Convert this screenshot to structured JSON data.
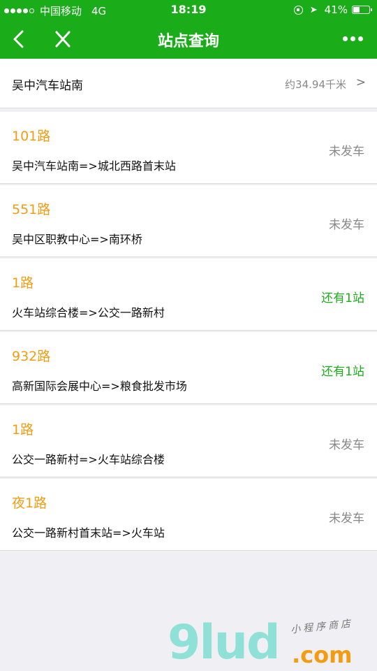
{
  "status_bar": {
    "signal_dots_filled": 4,
    "signal_dots_total": 5,
    "carrier": "中国移动",
    "network": "4G",
    "time": "18:19",
    "battery_text": "41%",
    "battery_level": 0.41
  },
  "nav": {
    "title": "站点查询"
  },
  "station": {
    "name": "吴中汽车站南",
    "distance": "约34.94千米",
    "chevron": ">"
  },
  "routes": [
    {
      "name": "101路",
      "direction": "吴中汽车站南=>城北西路首末站",
      "status": "未发车",
      "status_type": "not_departed"
    },
    {
      "name": "551路",
      "direction": "吴中区职教中心=>南环桥",
      "status": "未发车",
      "status_type": "not_departed"
    },
    {
      "name": "1路",
      "direction": "火车站综合楼=>公交一路新村",
      "status": "还有1站",
      "status_type": "near"
    },
    {
      "name": "932路",
      "direction": "高新国际会展中心=>粮食批发市场",
      "status": "还有1站",
      "status_type": "near"
    },
    {
      "name": "1路",
      "direction": "公交一路新村=>火车站综合楼",
      "status": "未发车",
      "status_type": "not_departed"
    },
    {
      "name": "夜1路",
      "direction": "公交一路新村首末站=>火车站",
      "status": "未发车",
      "status_type": "not_departed"
    }
  ],
  "watermark": {
    "logo": "9lud",
    "domain": ".com",
    "tagline": "小程序商店"
  },
  "colors": {
    "brand_green": "#1aad19",
    "route_orange": "#f39c12",
    "status_gray": "#888888",
    "background": "#efeff4"
  },
  "icons": {
    "back": "back-arrow-icon",
    "close": "close-icon",
    "more": "more-dots-icon",
    "chevron": "chevron-right-icon",
    "location": "location-arrow-icon",
    "lock": "orientation-lock-icon",
    "battery": "battery-icon"
  }
}
